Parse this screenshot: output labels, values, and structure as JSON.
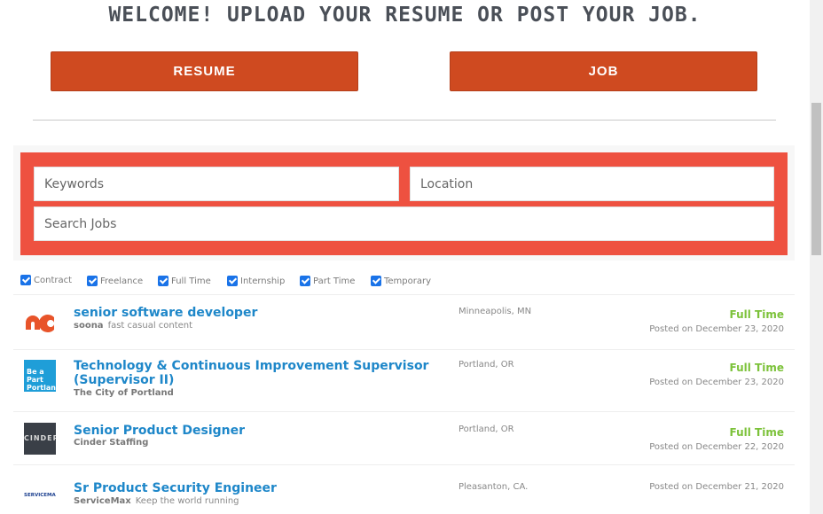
{
  "header": {
    "title": "WELCOME! UPLOAD YOUR RESUME OR POST YOUR JOB."
  },
  "cta": {
    "resume_label": "RESUME",
    "job_label": "JOB"
  },
  "search": {
    "keywords_placeholder": "Keywords",
    "location_placeholder": "Location",
    "search_jobs_label": "Search Jobs"
  },
  "filters": [
    {
      "label": "Contract",
      "checked": true
    },
    {
      "label": "Freelance",
      "checked": true
    },
    {
      "label": "Full Time",
      "checked": true
    },
    {
      "label": "Internship",
      "checked": true
    },
    {
      "label": "Part Time",
      "checked": true
    },
    {
      "label": "Temporary",
      "checked": true
    }
  ],
  "jobs": [
    {
      "title": "senior software developer",
      "company": "soona",
      "tagline": "fast casual content",
      "location": "Minneapolis, MN",
      "type": "Full Time",
      "posted": "Posted on December 23, 2020",
      "logo_icon": "soona-logo"
    },
    {
      "title": "Technology & Continuous Improvement Supervisor (Supervisor II)",
      "company": "The City of Portland",
      "tagline": "",
      "location": "Portland, OR",
      "type": "Full Time",
      "posted": "Posted on December 23, 2020",
      "logo_icon": "city-of-portland-logo",
      "logo_text": "Be a Part Portland"
    },
    {
      "title": "Senior Product Designer",
      "company": "Cinder Staffing",
      "tagline": "",
      "location": "Portland, OR",
      "type": "Full Time",
      "posted": "Posted on December 22, 2020",
      "logo_icon": "cinder-logo",
      "logo_text": "CINDER"
    },
    {
      "title": "Sr Product Security Engineer",
      "company": "ServiceMax",
      "tagline": "Keep the world running",
      "location": "Pleasanton, CA.",
      "type": "",
      "posted": "Posted on December 21, 2020",
      "logo_icon": "servicemax-logo",
      "logo_text": "SERVICEMAX"
    }
  ],
  "colors": {
    "accent": "#cf4a20",
    "search_bg": "#ee5140",
    "link": "#1e87c9",
    "job_type": "#7cc23a"
  }
}
